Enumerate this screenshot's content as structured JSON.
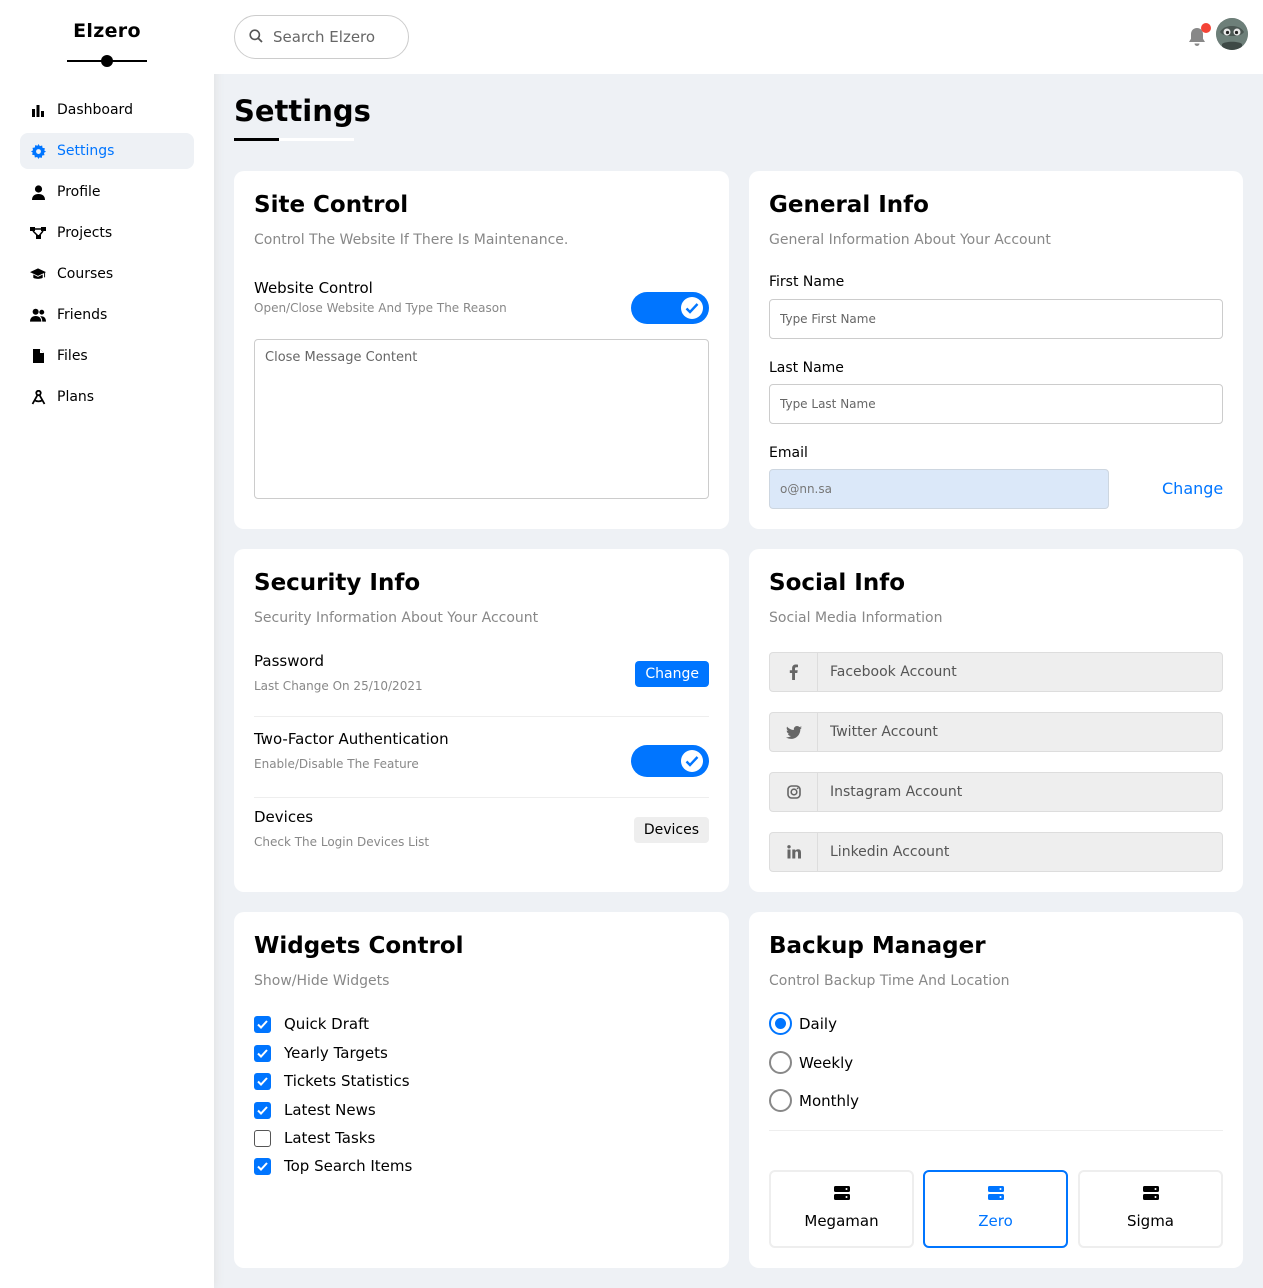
{
  "brand": {
    "title": "Elzero"
  },
  "sidebar": {
    "items": [
      {
        "label": "Dashboard",
        "icon": "chart-bar-icon",
        "active": false
      },
      {
        "label": "Settings",
        "icon": "gear-icon",
        "active": true
      },
      {
        "label": "Profile",
        "icon": "user-icon",
        "active": false
      },
      {
        "label": "Projects",
        "icon": "diagram-icon",
        "active": false
      },
      {
        "label": "Courses",
        "icon": "graduation-cap-icon",
        "active": false
      },
      {
        "label": "Friends",
        "icon": "users-icon",
        "active": false
      },
      {
        "label": "Files",
        "icon": "file-icon",
        "active": false
      },
      {
        "label": "Plans",
        "icon": "compass-icon",
        "active": false
      }
    ]
  },
  "header": {
    "search_placeholder": "Search Elzero"
  },
  "page": {
    "title": "Settings"
  },
  "site_control": {
    "title": "Site Control",
    "desc": "Control The Website If There Is Maintenance.",
    "row_title": "Website Control",
    "row_sub": "Open/Close Website And Type The Reason",
    "toggle_on": true,
    "textarea_placeholder": "Close Message Content"
  },
  "general_info": {
    "title": "General Info",
    "desc": "General Information About Your Account",
    "first_name_label": "First Name",
    "first_name_placeholder": "Type First Name",
    "last_name_label": "Last Name",
    "last_name_placeholder": "Type Last Name",
    "email_label": "Email",
    "email_value": "o@nn.sa",
    "change_label": "Change"
  },
  "security_info": {
    "title": "Security Info",
    "desc": "Security Information About Your Account",
    "password_title": "Password",
    "password_sub": "Last Change On 25/10/2021",
    "password_button": "Change",
    "twofa_title": "Two-Factor Authentication",
    "twofa_sub": "Enable/Disable The Feature",
    "twofa_on": true,
    "devices_title": "Devices",
    "devices_sub": "Check The Login Devices List",
    "devices_button": "Devices"
  },
  "social_info": {
    "title": "Social Info",
    "desc": "Social Media Information",
    "facebook_placeholder": "Facebook Account",
    "twitter_placeholder": "Twitter Account",
    "instagram_placeholder": "Instagram Account",
    "linkedin_placeholder": "Linkedin Account"
  },
  "widgets_control": {
    "title": "Widgets Control",
    "desc": "Show/Hide Widgets",
    "items": [
      {
        "label": "Quick Draft",
        "checked": true
      },
      {
        "label": "Yearly Targets",
        "checked": true
      },
      {
        "label": "Tickets Statistics",
        "checked": true
      },
      {
        "label": "Latest News",
        "checked": true
      },
      {
        "label": "Latest Tasks",
        "checked": false
      },
      {
        "label": "Top Search Items",
        "checked": true
      }
    ]
  },
  "backup_manager": {
    "title": "Backup Manager",
    "desc": "Control Backup Time And Location",
    "options": [
      {
        "label": "Daily",
        "selected": true
      },
      {
        "label": "Weekly",
        "selected": false
      },
      {
        "label": "Monthly",
        "selected": false
      }
    ],
    "servers": [
      {
        "label": "Megaman",
        "selected": false
      },
      {
        "label": "Zero",
        "selected": true
      },
      {
        "label": "Sigma",
        "selected": false
      }
    ]
  },
  "colors": {
    "accent": "#0075ff",
    "background": "#eef1f5",
    "notification": "#f44336"
  }
}
